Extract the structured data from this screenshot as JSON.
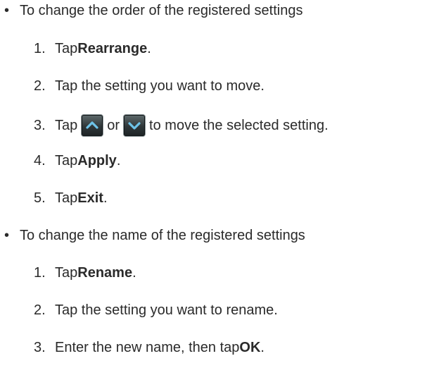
{
  "sections": [
    {
      "bullet": "•",
      "heading": "To change the order of the registered settings",
      "steps": [
        {
          "num": "1.",
          "pre": "Tap ",
          "bold": "Rearrange",
          "post": "."
        },
        {
          "num": "2.",
          "text": "Tap the setting you want to move."
        },
        {
          "num": "3.",
          "pre": "Tap",
          "mid": "or",
          "post": "to move the selected setting.",
          "icon_up": "arrow-up-icon",
          "icon_down": "arrow-down-icon"
        },
        {
          "num": "4.",
          "pre": "Tap ",
          "bold": "Apply",
          "post": "."
        },
        {
          "num": "5.",
          "pre": "Tap ",
          "bold": "Exit",
          "post": "."
        }
      ]
    },
    {
      "bullet": "•",
      "heading": "To change the name of the registered settings",
      "steps": [
        {
          "num": "1.",
          "pre": "Tap ",
          "bold": "Rename",
          "post": "."
        },
        {
          "num": "2.",
          "text": "Tap the setting you want to rename."
        },
        {
          "num": "3.",
          "pre": "Enter the new name, then tap ",
          "bold": "OK",
          "post": "."
        }
      ]
    }
  ],
  "colors": {
    "text": "#2a2a2a",
    "icon_bg": "#2f3739",
    "icon_arrow": "#6ec3e8"
  }
}
